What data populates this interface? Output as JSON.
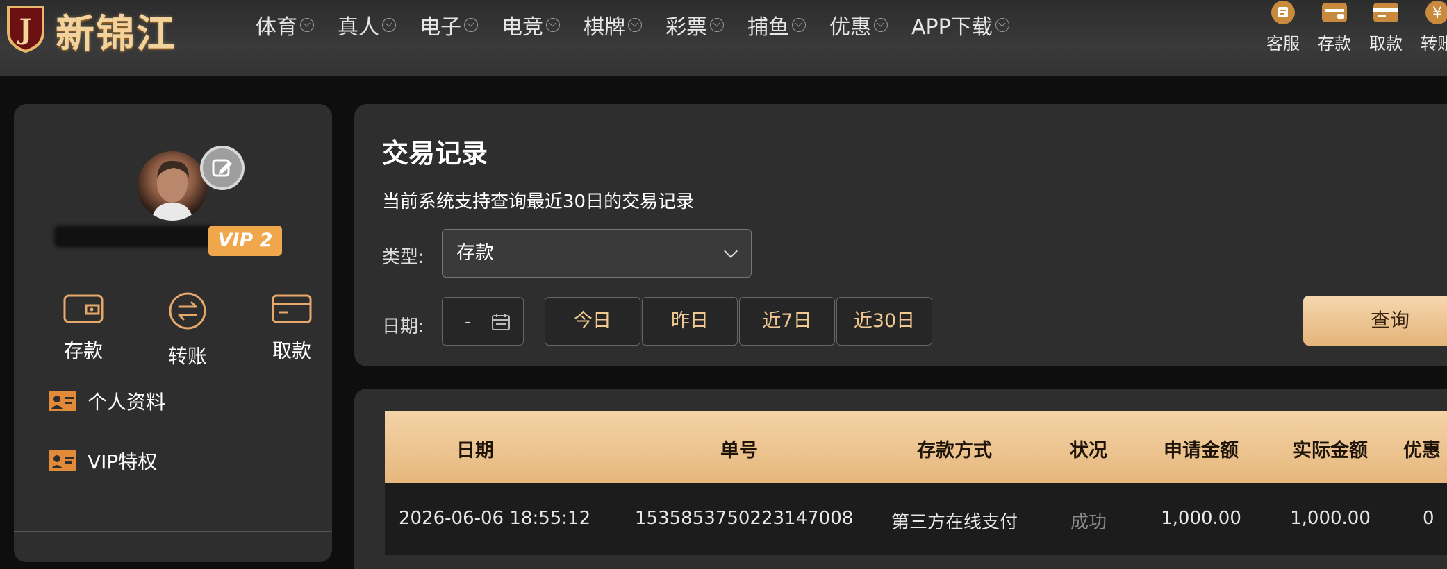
{
  "brand": {
    "name": "新锦江",
    "badge": "J"
  },
  "nav": [
    {
      "label": "体育"
    },
    {
      "label": "真人"
    },
    {
      "label": "电子"
    },
    {
      "label": "电竞"
    },
    {
      "label": "棋牌"
    },
    {
      "label": "彩票"
    },
    {
      "label": "捕鱼"
    },
    {
      "label": "优惠"
    },
    {
      "label": "APP下载"
    }
  ],
  "tools": [
    {
      "label": "客服",
      "icon": "customer-service-icon"
    },
    {
      "label": "存款",
      "icon": "deposit-icon"
    },
    {
      "label": "取款",
      "icon": "withdraw-icon"
    },
    {
      "label": "转账",
      "icon": "transfer-icon"
    }
  ],
  "user": {
    "vip": "VIP 2"
  },
  "quick_actions": [
    {
      "label": "存款",
      "icon": "wallet-icon"
    },
    {
      "label": "转账",
      "icon": "transfer-icon"
    },
    {
      "label": "取款",
      "icon": "card-icon"
    }
  ],
  "menu": [
    {
      "label": "个人资料",
      "icon": "id-card-icon"
    },
    {
      "label": "VIP特权",
      "icon": "id-card-icon"
    }
  ],
  "panel": {
    "title": "交易记录",
    "subtitle": "当前系统支持查询最近30日的交易记录",
    "type_label": "类型:",
    "type_value": "存款",
    "date_label": "日期:",
    "date_placeholder": "-",
    "quick_ranges": [
      "今日",
      "昨日",
      "近7日",
      "近30日"
    ],
    "search_label": "查询"
  },
  "table": {
    "headers": [
      "日期",
      "单号",
      "存款方式",
      "状况",
      "申请金额",
      "实际金额",
      "优惠"
    ],
    "rows": [
      [
        "2026-06-06 18:55:12",
        "1535853750223147008",
        "第三方在线支付",
        "成功",
        "1,000.00",
        "1,000.00",
        "0"
      ]
    ]
  },
  "colors": {
    "accent": "#e6b77d",
    "vip": "#f0a64a",
    "panel": "#2e2e2e"
  }
}
